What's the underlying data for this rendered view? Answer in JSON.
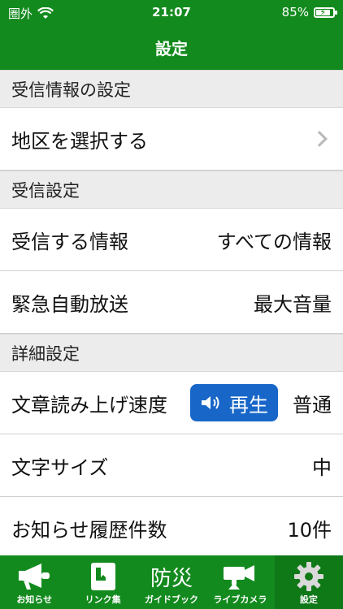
{
  "status_bar": {
    "carrier": "圏外",
    "time": "21:07",
    "battery_percent": "85%",
    "battery_level": 0.85
  },
  "nav": {
    "title": "設定"
  },
  "sections": [
    {
      "header": "受信情報の設定",
      "rows": [
        {
          "label": "地区を選択する"
        }
      ]
    },
    {
      "header": "受信設定",
      "rows": [
        {
          "label": "受信する情報",
          "value": "すべての情報"
        },
        {
          "label": "緊急自動放送",
          "value": "最大音量"
        }
      ]
    },
    {
      "header": "詳細設定",
      "rows": [
        {
          "label": "文章読み上げ速度",
          "button": "再生",
          "value": "普通"
        },
        {
          "label": "文字サイズ",
          "value": "中"
        },
        {
          "label": "お知らせ履歴件数",
          "value": "10件"
        }
      ]
    }
  ],
  "tabs": [
    {
      "label": "お知らせ",
      "icon": "megaphone-icon"
    },
    {
      "label": "リンク集",
      "icon": "book-icon"
    },
    {
      "label": "ガイドブック",
      "icon": "bousai-text-icon",
      "icon_text": "防災"
    },
    {
      "label": "ライブカメラ",
      "icon": "camera-icon"
    },
    {
      "label": "設定",
      "icon": "gear-icon",
      "active": true
    }
  ],
  "colors": {
    "primary": "#138a1e",
    "button": "#1766c8",
    "section_bg": "#ececec"
  }
}
